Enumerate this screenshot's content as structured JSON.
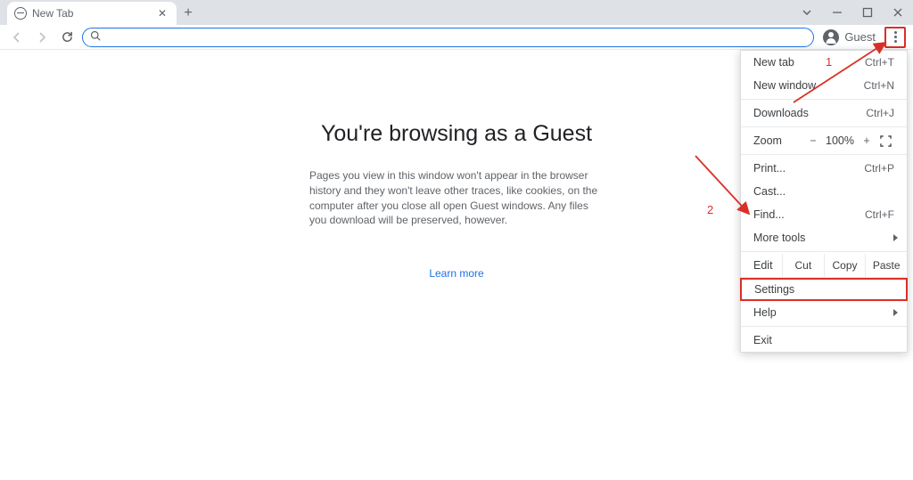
{
  "tab": {
    "title": "New Tab"
  },
  "user": {
    "label": "Guest"
  },
  "content": {
    "heading": "You're browsing as a Guest",
    "paragraph": "Pages you view in this window won't appear in the browser history and they won't leave other traces, like cookies, on the computer after you close all open Guest windows. Any files you download will be preserved, however.",
    "learn_more": "Learn more"
  },
  "menu": {
    "new_tab": {
      "label": "New tab",
      "accel": "Ctrl+T"
    },
    "new_window": {
      "label": "New window",
      "accel": "Ctrl+N"
    },
    "downloads": {
      "label": "Downloads",
      "accel": "Ctrl+J"
    },
    "zoom": {
      "label": "Zoom",
      "minus": "−",
      "value": "100%",
      "plus": "+"
    },
    "print": {
      "label": "Print...",
      "accel": "Ctrl+P"
    },
    "cast": {
      "label": "Cast..."
    },
    "find": {
      "label": "Find...",
      "accel": "Ctrl+F"
    },
    "more_tools": {
      "label": "More tools"
    },
    "edit": {
      "label": "Edit",
      "cut": "Cut",
      "copy": "Copy",
      "paste": "Paste"
    },
    "settings": {
      "label": "Settings"
    },
    "help": {
      "label": "Help"
    },
    "exit": {
      "label": "Exit"
    }
  },
  "annotations": {
    "one": "1",
    "two": "2"
  }
}
